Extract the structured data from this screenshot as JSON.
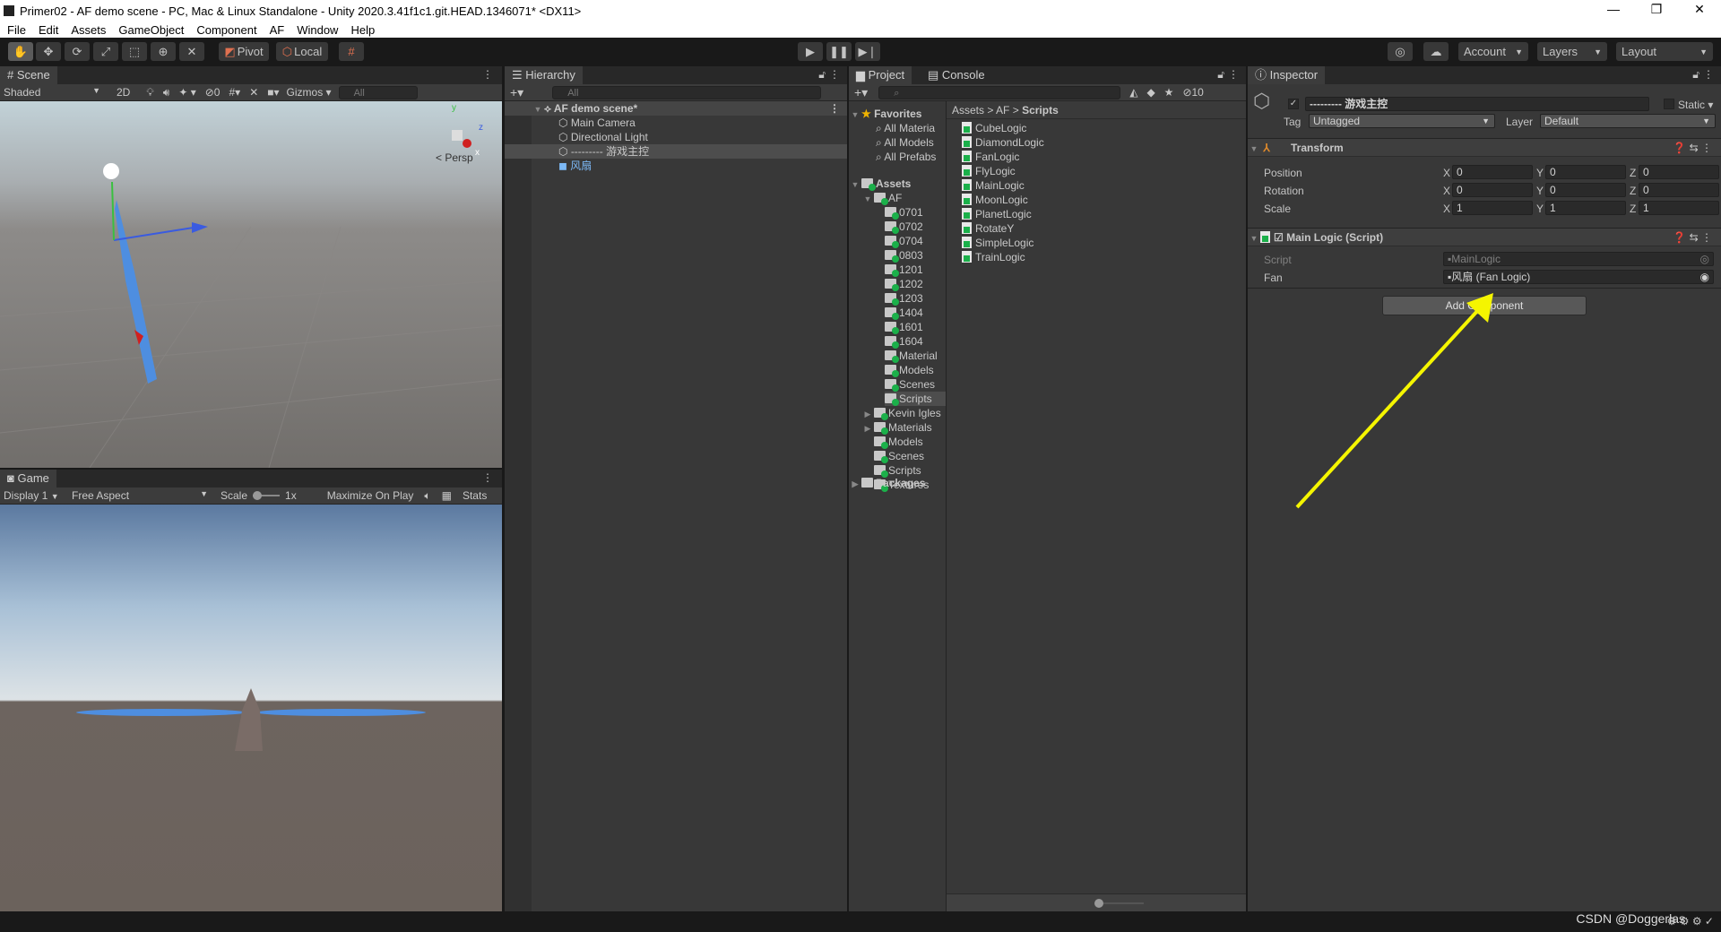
{
  "window": {
    "title": "Primer02 - AF demo scene - PC, Mac & Linux Standalone - Unity 2020.3.41f1c1.git.HEAD.1346071* <DX11>",
    "minimize": "—",
    "restore": "❐",
    "close": "✕"
  },
  "menu": [
    "File",
    "Edit",
    "Assets",
    "GameObject",
    "Component",
    "AF",
    "Window",
    "Help"
  ],
  "toolbar": {
    "pivot": "Pivot",
    "local": "Local",
    "account": "Account",
    "layers": "Layers",
    "layout": "Layout"
  },
  "scene": {
    "tab": "Scene",
    "shading": "Shaded",
    "mode_2d": "2D",
    "hidden_count": "0",
    "gizmos": "Gizmos",
    "search_placeholder": "All",
    "persp": "Persp",
    "axis_y": "y",
    "axis_x": "x",
    "axis_z": "z"
  },
  "game": {
    "tab": "Game",
    "display": "Display 1",
    "aspect": "Free Aspect",
    "scale_label": "Scale",
    "scale_value": "1x",
    "maximize": "Maximize On Play",
    "stats": "Stats"
  },
  "hierarchy": {
    "tab": "Hierarchy",
    "search_placeholder": "All",
    "scene_name": "AF demo scene*",
    "items": [
      {
        "label": "Main Camera"
      },
      {
        "label": "Directional Light"
      },
      {
        "label": "--------- 游戏主控",
        "selected": true
      },
      {
        "label": "风扇",
        "prefab": true
      }
    ]
  },
  "project": {
    "tab": "Project",
    "console_tab": "Console",
    "hidden_count": "10",
    "favorites": {
      "label": "Favorites",
      "items": [
        "All Materia",
        "All Models",
        "All Prefabs"
      ]
    },
    "assets_label": "Assets",
    "af_label": "AF",
    "af_children": [
      "0701",
      "0702",
      "0704",
      "0803",
      "1201",
      "1202",
      "1203",
      "1404",
      "1601",
      "1604",
      "Material",
      "Models",
      "Scenes",
      "Scripts"
    ],
    "assets_children": [
      {
        "label": "Kevin Igles",
        "expandable": true
      },
      {
        "label": "Materials",
        "expandable": true
      },
      {
        "label": "Models"
      },
      {
        "label": "Scenes"
      },
      {
        "label": "Scripts"
      },
      {
        "label": "Textures"
      }
    ],
    "packages_label": "Packages",
    "breadcrumb": [
      "Assets",
      "AF",
      "Scripts"
    ],
    "files": [
      "CubeLogic",
      "DiamondLogic",
      "FanLogic",
      "FlyLogic",
      "MainLogic",
      "MoonLogic",
      "PlanetLogic",
      "RotateY",
      "SimpleLogic",
      "TrainLogic"
    ]
  },
  "inspector": {
    "tab": "Inspector",
    "object_name": "--------- 游戏主控",
    "static_label": "Static",
    "tag_label": "Tag",
    "tag_value": "Untagged",
    "layer_label": "Layer",
    "layer_value": "Default",
    "transform": {
      "title": "Transform",
      "rows": [
        {
          "label": "Position",
          "x": "0",
          "y": "0",
          "z": "0"
        },
        {
          "label": "Rotation",
          "x": "0",
          "y": "0",
          "z": "0"
        },
        {
          "label": "Scale",
          "x": "1",
          "y": "1",
          "z": "1"
        }
      ]
    },
    "script": {
      "title": "Main Logic (Script)",
      "script_label": "Script",
      "script_value": "MainLogic",
      "fan_label": "Fan",
      "fan_value": "风扇 (Fan Logic)"
    },
    "add_component": "Add Component"
  },
  "watermark": "CSDN @Doggerlas",
  "colors": {
    "accent_arrow": "#f5f500",
    "selection": "#4d4d4d",
    "prefab_text": "#7cb8f5"
  }
}
